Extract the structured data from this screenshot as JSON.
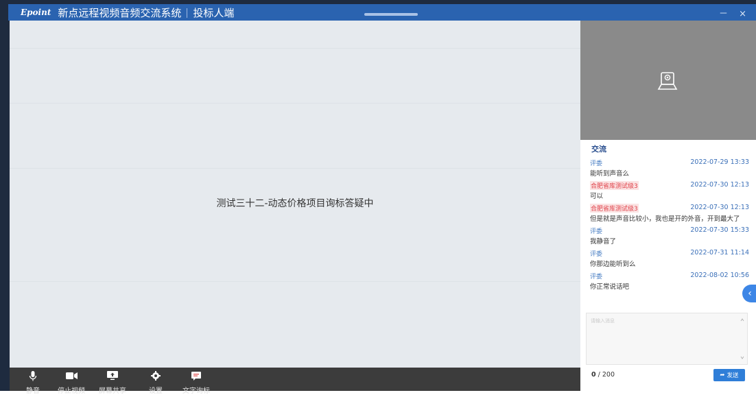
{
  "window": {
    "logo_text": "Epoint",
    "app_title": "新点远程视频音频交流系统",
    "role_title": "投标人端",
    "controls": "－ ×"
  },
  "main": {
    "status_text": "测试三十二-动态价格项目询标答疑中"
  },
  "toolbar": {
    "items": [
      {
        "label": "静音",
        "icon": "microphone-icon"
      },
      {
        "label": "停止视频",
        "icon": "video-camera-icon"
      },
      {
        "label": "屏幕共享",
        "icon": "screen-share-icon"
      },
      {
        "label": "设置",
        "icon": "gear-icon"
      },
      {
        "label": "文字询标",
        "icon": "chat-bubble-icon"
      }
    ]
  },
  "sidebar": {
    "camera_icon": "webcam-icon",
    "chat_title": "交流",
    "messages": [
      {
        "sender": "评委",
        "time": "2022-07-29 13:33",
        "text": "能听到声音么"
      },
      {
        "sender": "合肥省库测试级3",
        "time": "2022-07-30 12:13",
        "text": "可以"
      },
      {
        "sender": "合肥省库测试级3",
        "time": "2022-07-30 12:13",
        "text": "但是就是声音比较小，我也是开的外音，开到最大了"
      },
      {
        "sender": "评委",
        "time": "2022-07-30 15:33",
        "text": "我静音了"
      },
      {
        "sender": "评委",
        "time": "2022-07-31 11:14",
        "text": "你那边能听到么"
      },
      {
        "sender": "评委",
        "time": "2022-08-02 10:56",
        "text": "你正常说话吧"
      }
    ],
    "input_placeholder": "请输入消息",
    "char_count": "0",
    "char_limit": "/ 200",
    "send_label": "发送"
  },
  "colors": {
    "titlebar": "#2a63b0",
    "toolbar": "#3c3c3c",
    "accent": "#2f7ed8",
    "highlight_sender": "#e0434b"
  }
}
